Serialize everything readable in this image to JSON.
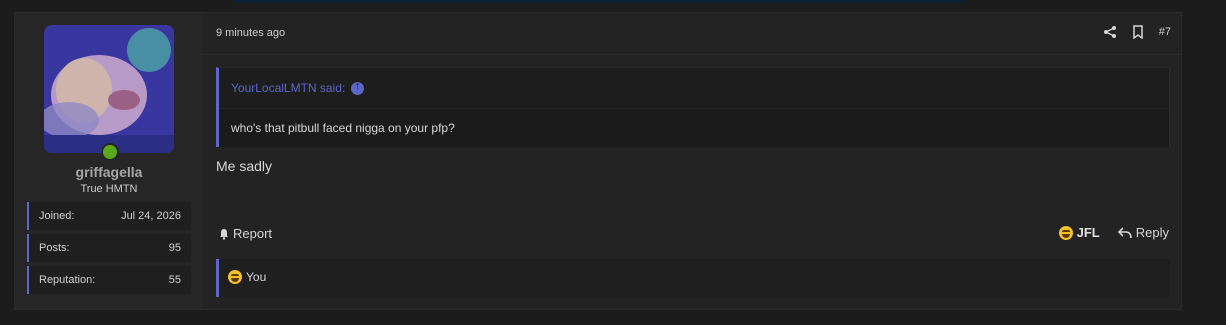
{
  "post": {
    "user": {
      "username": "griffagella",
      "title": "True HMTN",
      "online": true,
      "stats": [
        {
          "key": "Joined:",
          "value": "Jul 24, 2026"
        },
        {
          "key": "Posts:",
          "value": "95"
        },
        {
          "key": "Reputation:",
          "value": "55"
        }
      ]
    },
    "header": {
      "time": "9 minutes ago",
      "post_number": "#7",
      "icons": [
        "share-icon",
        "bookmark-icon"
      ]
    },
    "quote": {
      "author": "YourLocalLMTN said:",
      "body": "who's that pitbull faced nigga on your pfp?"
    },
    "message": "Me sadly",
    "footer": {
      "report_label": "Report",
      "reaction_label": "JFL",
      "reply_label": "Reply"
    },
    "reactions_bar": {
      "text": "You"
    }
  },
  "colors": {
    "accent": "#5b68c8",
    "online": "#5aa91c",
    "background": "#1c1c1c",
    "panel": "#232323"
  }
}
